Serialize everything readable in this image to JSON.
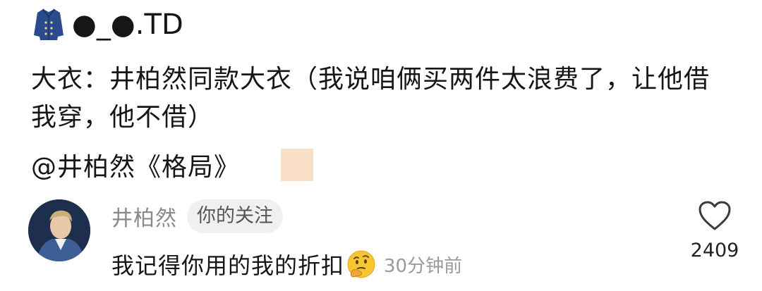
{
  "post": {
    "author": "●_●.TD",
    "text": "大衣：井柏然同款大衣（我说咱俩买两件太浪费了，让他借我穿，他不借）",
    "mention": "@井柏然《格局》",
    "author_icon": "coat-icon",
    "trailing_icon": "emoji-placeholder"
  },
  "comment": {
    "author": "井柏然",
    "badge": "你的关注",
    "text": "我记得你用的我的折扣",
    "emoji": "thinking-face-emoji",
    "time": "30分钟前",
    "likes": "2409",
    "like_icon": "heart-outline-icon"
  },
  "colors": {
    "text_primary": "#161616",
    "text_secondary": "#8a8a8a",
    "badge_bg": "#f0f0f0",
    "coat_blue": "#2a4c8c",
    "emoji_square": "#fbe0c8"
  }
}
